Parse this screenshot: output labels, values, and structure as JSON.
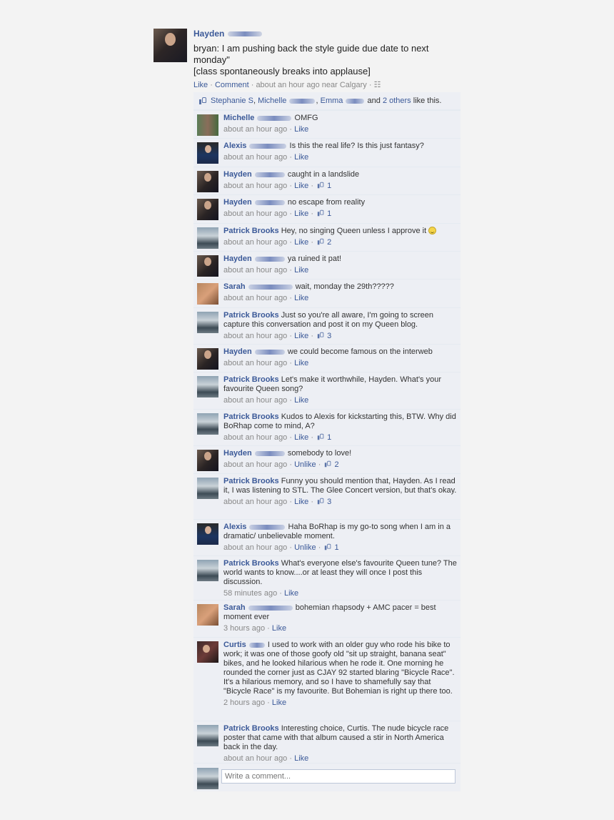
{
  "post": {
    "author": "Hayden",
    "lines": [
      "bryan: I am pushing back the style guide due date to next monday\"",
      "[class spontaneously breaks into applause]"
    ],
    "meta": {
      "like": "Like",
      "comment": "Comment",
      "time": "about an hour ago near Calgary"
    }
  },
  "likes": {
    "segments": [
      "Stephanie S",
      "Michelle",
      "Emma",
      "2 others"
    ],
    "and": "and",
    "suffix": "like this."
  },
  "comments": [
    {
      "name": "Michelle",
      "text": "OMFG",
      "time": "about an hour ago",
      "action": "Like",
      "likes": ""
    },
    {
      "name": "Alexis",
      "text": "Is this the real life? Is this just fantasy?",
      "time": "about an hour ago",
      "action": "Like",
      "likes": ""
    },
    {
      "name": "Hayden",
      "text": "caught in a landslide",
      "time": "about an hour ago",
      "action": "Like",
      "likes": "1"
    },
    {
      "name": "Hayden",
      "text": "no escape from reality",
      "time": "about an hour ago",
      "action": "Like",
      "likes": "1"
    },
    {
      "name": "Patrick Brooks",
      "text": "Hey, no singing Queen unless I approve it",
      "time": "about an hour ago",
      "action": "Like",
      "likes": "2"
    },
    {
      "name": "Hayden",
      "text": "ya ruined it pat!",
      "time": "about an hour ago",
      "action": "Like",
      "likes": ""
    },
    {
      "name": "Sarah",
      "text": "wait, monday the 29th?????",
      "time": "about an hour ago",
      "action": "Like",
      "likes": ""
    },
    {
      "name": "Patrick Brooks",
      "text": "Just so you're all aware, I'm going to screen capture this conversation and post it on my Queen blog.",
      "time": "about an hour ago",
      "action": "Like",
      "likes": "3"
    },
    {
      "name": "Hayden",
      "text": "we could become famous on the interweb",
      "time": "about an hour ago",
      "action": "Like",
      "likes": ""
    },
    {
      "name": "Patrick Brooks",
      "text": "Let's make it worthwhile, Hayden. What's your favourite Queen song?",
      "time": "about an hour ago",
      "action": "Like",
      "likes": ""
    },
    {
      "name": "Patrick Brooks",
      "text": "Kudos to Alexis for kickstarting this, BTW. Why did BoRhap come to mind, A?",
      "time": "about an hour ago",
      "action": "Like",
      "likes": "1"
    },
    {
      "name": "Hayden",
      "text": "somebody to love!",
      "time": "about an hour ago",
      "action": "Unlike",
      "likes": "2"
    },
    {
      "name": "Patrick Brooks",
      "text": "Funny you should mention that, Hayden. As I read it, I was listening to STL. The Glee Concert version, but that's okay.",
      "time": "about an hour ago",
      "action": "Like",
      "likes": "3"
    },
    {
      "name": "Alexis",
      "text": "Haha BoRhap is my go-to song when I am in a dramatic/ unbelievable moment.",
      "time": "about an hour ago",
      "action": "Unlike",
      "likes": "1"
    },
    {
      "name": "Patrick Brooks",
      "text": "What's everyone else's favourite Queen tune? The world wants to know....or at least they will once I post this discussion.",
      "time": "58 minutes ago",
      "action": "Like",
      "likes": ""
    },
    {
      "name": "Sarah",
      "text": "bohemian rhapsody + AMC pacer = best moment ever",
      "time": "3 hours ago",
      "action": "Like",
      "likes": ""
    },
    {
      "name": "Curtis",
      "text": "I used to work with an older guy who rode his bike to work; it was one of those goofy old \"sit up straight, banana seat\" bikes, and he looked hilarious when he rode it. One morning he rounded the corner just as CJAY 92 started blaring \"Bicycle Race\". It's a hilarious memory, and so I have to shamefully say that \"Bicycle Race\" is my favourite. But Bohemian is right up there too.",
      "time": "2 hours ago",
      "action": "Like",
      "likes": ""
    },
    {
      "name": "Patrick Brooks",
      "text": "Interesting choice, Curtis. The nude bicycle race poster that came with that album caused a stir in North America back in the day.",
      "time": "about an hour ago",
      "action": "Like",
      "likes": ""
    }
  ],
  "composer": {
    "placeholder": "Write a comment..."
  },
  "colors": {
    "link": "#3b5998",
    "panel": "#edeff4",
    "meta": "#888888"
  }
}
